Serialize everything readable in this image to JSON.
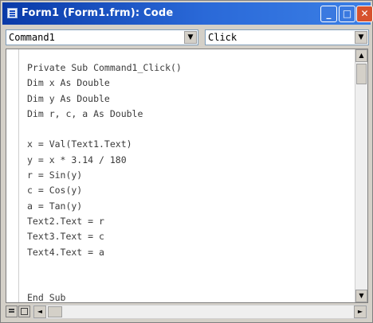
{
  "window": {
    "title": "Form1 (Form1.frm): Code",
    "minimize_symbol": "_",
    "maximize_symbol": "□",
    "close_symbol": "✕"
  },
  "object_combo": {
    "value": "Command1",
    "arrow": "▼"
  },
  "procedure_combo": {
    "value": "Click",
    "arrow": "▼"
  },
  "code_lines": [
    "Private Sub Command1_Click()",
    "Dim x As Double",
    "Dim y As Double",
    "Dim r, c, a As Double",
    "",
    "x = Val(Text1.Text)",
    "y = x * 3.14 / 180",
    "r = Sin(y)",
    "c = Cos(y)",
    "a = Tan(y)",
    "Text2.Text = r",
    "Text3.Text = c",
    "Text4.Text = a",
    "",
    "",
    "End Sub"
  ],
  "scrollbars": {
    "up_arrow": "▲",
    "down_arrow": "▼",
    "left_arrow": "◄",
    "right_arrow": "►"
  },
  "colors": {
    "titlebar": "#0a3aa8",
    "code_text": "#3a3a3a",
    "window_bg": "#d4d0c8"
  }
}
